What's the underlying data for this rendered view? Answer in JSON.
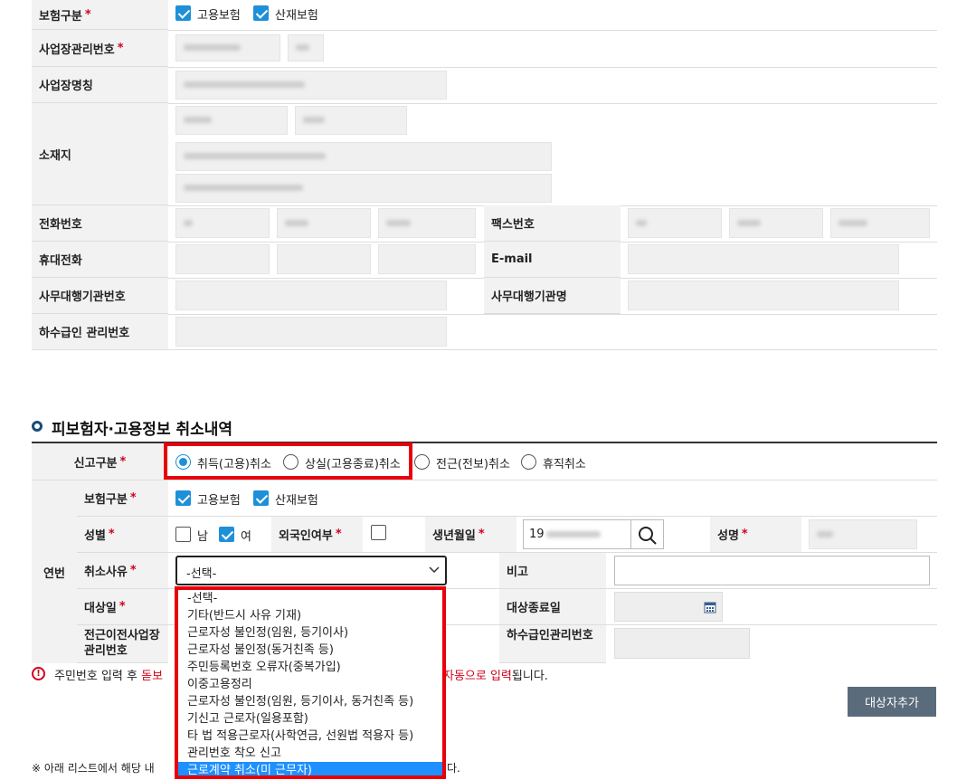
{
  "company": {
    "insurance_type_label": "보험구분",
    "employment_insurance": "고용보험",
    "industrial_insurance": "산재보험",
    "workplace_no_label": "사업장관리번호",
    "workplace_name_label": "사업장명칭",
    "address_label": "소재지",
    "phone_label": "전화번호",
    "fax_label": "팩스번호",
    "mobile_label": "휴대전화",
    "email_label": "E-mail",
    "agency_no_label": "사무대행기관번호",
    "agency_name_label": "사무대행기관명",
    "subcontract_label": "하수급인 관리번호"
  },
  "section": {
    "title": "피보험자·고용정보 취소내역"
  },
  "form": {
    "report_type_label": "신고구분",
    "report_options": [
      "취득(고용)취소",
      "상실(고용종료)취소",
      "전근(전보)취소",
      "휴직취소"
    ],
    "row_header": "연번",
    "insurance_type_label": "보험구분",
    "employment_insurance": "고용보험",
    "industrial_insurance": "산재보험",
    "gender_label": "성별",
    "male": "남",
    "female": "여",
    "foreigner_label": "외국인여부",
    "birth_label": "생년월일",
    "birth_value": "19",
    "name_label": "성명",
    "cancel_reason_label": "취소사유",
    "cancel_reason_value": "-선택-",
    "note_label": "비고",
    "target_date_label": "대상일",
    "target_end_label": "대상종료일",
    "prev_workplace_label": "전근이전사업장 관리번호",
    "subcontract_no_label": "하수급인관리번호",
    "notice_prefix": "주민번호 입력 후 ",
    "notice_red1": "돋보",
    "notice_red2": "자동으로 입력",
    "notice_suffix": "됩니다.",
    "add_button": "대상자추가",
    "bottom_note_prefix": "※ 아래 리스트에서 해당 내",
    "bottom_note_suffix": "다."
  },
  "dropdown": {
    "options": [
      "-선택-",
      "기타(반드시 사유 기재)",
      "근로자성 불인정(임원, 등기이사)",
      "근로자성 불인정(동거친족 등)",
      "주민등록번호 오류자(중복가입)",
      "이중고용정리",
      "근로자성 불인정(임원, 등기이사, 동거친족 등)",
      "기신고 근로자(일용포함)",
      "타 법 적용근로자(사학연금, 선원법 적용자 등)",
      "관리번호 착오 신고",
      "근로계약 취소(미 근무자)"
    ],
    "selected_index": 10
  },
  "colors": {
    "accent": "#1e90d8",
    "highlight_border": "#e8000b",
    "selected_bg": "#1e90ff",
    "button_bg": "#5a6b7b"
  }
}
